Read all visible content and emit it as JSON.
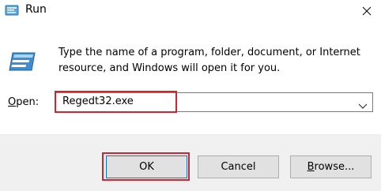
{
  "window": {
    "title": "Run",
    "title_icon": "run-icon",
    "close_icon": "close-icon"
  },
  "body": {
    "description": "Type the name of a program, folder, document, or Internet resource, and Windows will open it for you.",
    "big_icon": "run-icon"
  },
  "open": {
    "label_accel": "O",
    "label_rest": "pen:",
    "value": "Regedt32.exe",
    "dropdown_icon": "chevron-down-icon"
  },
  "buttons": {
    "ok": "OK",
    "cancel": "Cancel",
    "browse_accel": "B",
    "browse_rest": "rowse..."
  },
  "colors": {
    "highlight_box": "#d1242f",
    "default_button_border": "#0078d7",
    "footer_bg": "#f0f0f0"
  }
}
